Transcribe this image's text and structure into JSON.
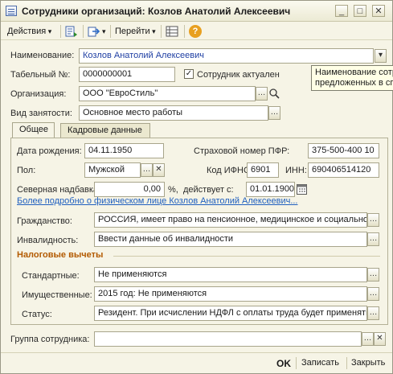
{
  "window": {
    "title": "Сотрудники организаций: Козлов Анатолий Алексеевич",
    "minimize": "_",
    "maximize": "□",
    "close": "✕"
  },
  "toolbar": {
    "actions_label": "Действия",
    "goto_label": "Перейти",
    "help_label": "?"
  },
  "form": {
    "name_label": "Наименование:",
    "name_value": "Козлов Анатолий Алексеевич",
    "tabnum_label": "Табельный №:",
    "tabnum_value": "0000000001",
    "active_label": "Сотрудник актуален",
    "active_check": "✓",
    "org_label": "Организация:",
    "org_value": "ООО \"ЕвроСтиль\"",
    "employment_label": "Вид занятости:",
    "employment_value": "Основное место работы",
    "group_label": "Группа сотрудника:",
    "group_value": ""
  },
  "tooltip": {
    "line1": "Наименование сотр",
    "line2": "предложенных в спи"
  },
  "tabs": {
    "general": "Общее",
    "hr": "Кадровые данные"
  },
  "general": {
    "birth_label": "Дата рождения:",
    "birth_value": "04.11.1950",
    "snils_label": "Страховой номер ПФР:",
    "snils_value": "375-500-400 10",
    "gender_label": "Пол:",
    "gender_value": "Мужской",
    "ifns_label": "Код ИФНС:",
    "ifns_value": "6901",
    "inn_label": "ИНН:",
    "inn_value": "690406514120",
    "north_label": "Северная надбавка:",
    "north_value": "0,00",
    "north_unit": "%,",
    "valid_label": "действует с:",
    "valid_value": "01.01.1900",
    "details_link": "Более подробно о физическом лице Козлов Анатолий Алексеевич...",
    "citizenship_label": "Гражданство:",
    "citizenship_value": "РОССИЯ, имеет право на пенсионное, медицинское и социальное",
    "disability_label": "Инвалидность:",
    "disability_value": "Ввести данные об инвалидности",
    "tax_section": "Налоговые вычеты",
    "standard_label": "Стандартные:",
    "standard_value": "Не применяются",
    "property_label": "Имущественные:",
    "property_value": "2015 год: Не применяются",
    "status_label": "Статус:",
    "status_value": "Резидент. При исчислении НДФЛ с оплаты труда будет применятьс"
  },
  "bottom": {
    "ok": "OK",
    "save": "Записать",
    "close": "Закрыть"
  },
  "colors": {
    "background": "#f6f4e6",
    "link": "#1f5fbf",
    "section": "#b35a00"
  }
}
